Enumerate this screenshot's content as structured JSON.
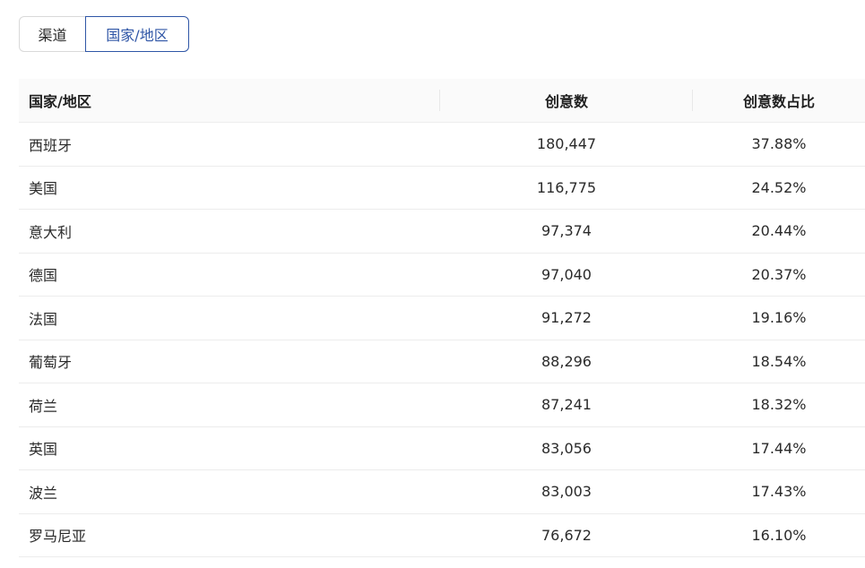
{
  "tabs": {
    "channel": "渠道",
    "country": "国家/地区"
  },
  "table": {
    "headers": {
      "country": "国家/地区",
      "creatives": "创意数",
      "share": "创意数占比"
    },
    "rows": [
      {
        "country": "西班牙",
        "creatives": "180,447",
        "share": "37.88%"
      },
      {
        "country": "美国",
        "creatives": "116,775",
        "share": "24.52%"
      },
      {
        "country": "意大利",
        "creatives": "97,374",
        "share": "20.44%"
      },
      {
        "country": "德国",
        "creatives": "97,040",
        "share": "20.37%"
      },
      {
        "country": "法国",
        "creatives": "91,272",
        "share": "19.16%"
      },
      {
        "country": "葡萄牙",
        "creatives": "88,296",
        "share": "18.54%"
      },
      {
        "country": "荷兰",
        "creatives": "87,241",
        "share": "18.32%"
      },
      {
        "country": "英国",
        "creatives": "83,056",
        "share": "17.44%"
      },
      {
        "country": "波兰",
        "creatives": "83,003",
        "share": "17.43%"
      },
      {
        "country": "罗马尼亚",
        "creatives": "76,672",
        "share": "16.10%"
      }
    ]
  },
  "colors": {
    "active_tab": "#2f56a6",
    "header_bg": "#fafafa",
    "row_border": "#ececec"
  }
}
